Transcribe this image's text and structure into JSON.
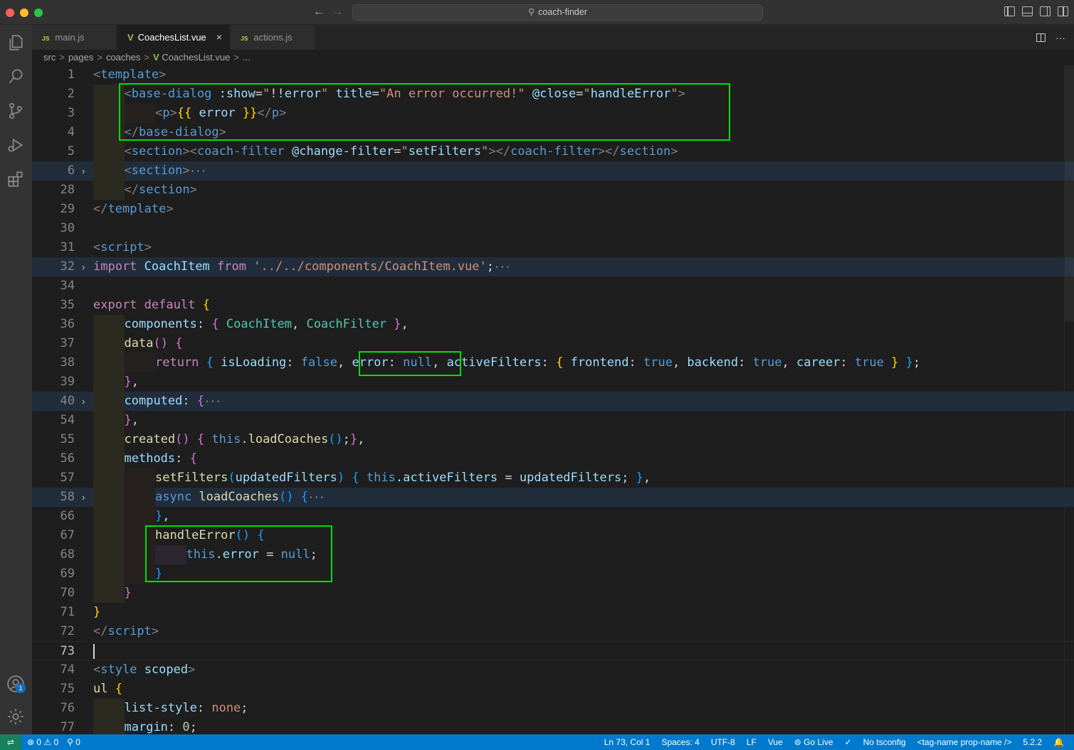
{
  "window": {
    "title": "coach-finder"
  },
  "tabs": [
    {
      "icon": "JS",
      "label": "main.js"
    },
    {
      "icon": "V",
      "label": "CoachesList.vue",
      "close": "×"
    },
    {
      "icon": "JS",
      "label": "actions.js"
    }
  ],
  "tab_actions": {
    "more": "···"
  },
  "breadcrumb": [
    "src",
    "pages",
    "coaches",
    "CoachesList.vue",
    "..."
  ],
  "breadcrumb_sep": ">",
  "breadcrumb_vue_icon": "V",
  "nav": {
    "back": "←",
    "forward": "→"
  },
  "account_badge": "1",
  "editor": {
    "line_numbers": [
      "1",
      "2",
      "3",
      "4",
      "5",
      "6",
      "28",
      "29",
      "30",
      "31",
      "32",
      "34",
      "35",
      "36",
      "37",
      "38",
      "39",
      "40",
      "54",
      "55",
      "56",
      "57",
      "58",
      "66",
      "67",
      "68",
      "69",
      "70",
      "71",
      "72",
      "73",
      "74",
      "75",
      "76",
      "77"
    ],
    "folded_marker": "···",
    "fold_chevron": "›"
  },
  "statusbar": {
    "remote": "⇌",
    "problems": "⊗ 0 ⚠ 0",
    "ports": "⚲ 0",
    "position": "Ln 73, Col 1",
    "spaces": "Spaces: 4",
    "encoding": "UTF-8",
    "eol": "LF",
    "language": "Vue",
    "golive": "Go Live",
    "prettier_icon": "✓",
    "tsconfig": "No tsconfig",
    "tag_mode": "<tag-name prop-name />",
    "version": "5.2.2",
    "bell": "🔔"
  },
  "colors": {
    "accent": "#007acc",
    "highlight_box": "#00e000",
    "remote": "#16825d"
  },
  "icons": [
    "explorer-icon",
    "search-icon",
    "source-control-icon",
    "run-debug-icon",
    "extensions-icon",
    "account-icon",
    "settings-gear-icon"
  ]
}
